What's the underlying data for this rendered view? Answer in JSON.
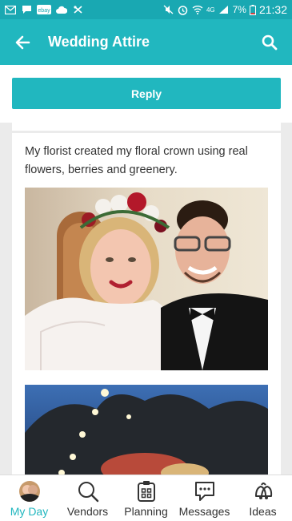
{
  "status_bar": {
    "left_icons": [
      "gmail-icon",
      "chat-icon",
      "ebay-icon",
      "cloud-icon",
      "crossed-icon"
    ],
    "ebay_label": "ebay",
    "network_label": "4G",
    "battery_percent": "7%",
    "time": "21:32"
  },
  "app_bar": {
    "title": "Wedding Attire",
    "back_icon": "arrow-left-icon",
    "search_icon": "search-icon",
    "color": "#21b7bf"
  },
  "reply": {
    "label": "Reply"
  },
  "post": {
    "text": "My florist created my floral crown using real flowers, berries and greenery."
  },
  "bottom_nav": {
    "items": [
      {
        "label": "My Day",
        "icon": "avatar",
        "active": true
      },
      {
        "label": "Vendors",
        "icon": "search-icon",
        "active": false
      },
      {
        "label": "Planning",
        "icon": "planner-icon",
        "active": false
      },
      {
        "label": "Messages",
        "icon": "message-icon",
        "active": false
      },
      {
        "label": "Ideas",
        "icon": "bells-icon",
        "active": false
      }
    ]
  },
  "colors": {
    "accent": "#21b7bf",
    "status_bar": "#19a8b2",
    "background": "#ebebeb"
  }
}
